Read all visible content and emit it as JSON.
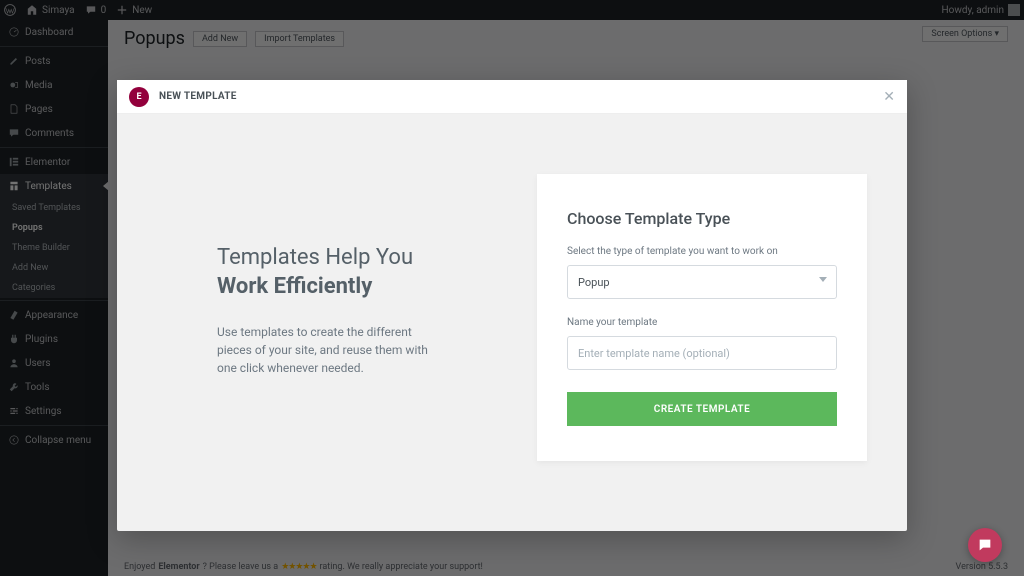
{
  "adminbar": {
    "site_name": "Simaya",
    "comments_count": "0",
    "new_label": "New",
    "howdy": "Howdy, admin"
  },
  "sidebar": {
    "items": [
      {
        "label": "Dashboard"
      },
      {
        "label": "Posts"
      },
      {
        "label": "Media"
      },
      {
        "label": "Pages"
      },
      {
        "label": "Comments"
      },
      {
        "label": "Elementor"
      },
      {
        "label": "Templates"
      },
      {
        "label": "Appearance"
      },
      {
        "label": "Plugins"
      },
      {
        "label": "Users"
      },
      {
        "label": "Tools"
      },
      {
        "label": "Settings"
      },
      {
        "label": "Collapse menu"
      }
    ],
    "submenu": [
      {
        "label": "Saved Templates"
      },
      {
        "label": "Popups"
      },
      {
        "label": "Theme Builder"
      },
      {
        "label": "Add New"
      },
      {
        "label": "Categories"
      }
    ]
  },
  "page": {
    "title": "Popups",
    "add_new_btn": "Add New",
    "import_btn": "Import Templates",
    "screen_options": "Screen Options",
    "footer_pre": "Enjoyed",
    "footer_name": "Elementor",
    "footer_mid": "? Please leave us a",
    "footer_post": "rating. We really appreciate your support!",
    "version": "Version 5.5.3"
  },
  "modal": {
    "header_title": "NEW TEMPLATE",
    "left_h1_a": "Templates Help You",
    "left_h1_b": "Work Efficiently",
    "left_p": "Use templates to create the different pieces of your site, and reuse them with one click whenever needed.",
    "right_h2": "Choose Template Type",
    "select_label": "Select the type of template you want to work on",
    "select_value": "Popup",
    "name_label": "Name your template",
    "name_placeholder": "Enter template name (optional)",
    "create_btn": "CREATE TEMPLATE"
  }
}
